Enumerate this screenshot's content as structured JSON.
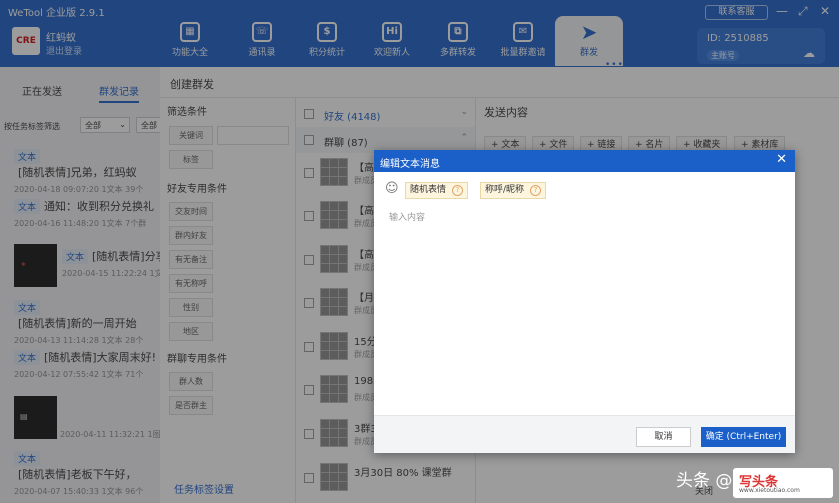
{
  "app": {
    "title": "WeTool 企业版 2.9.1",
    "support": "联系客服",
    "controls": [
      "—",
      "⤢",
      "✕"
    ]
  },
  "user": {
    "avatar_text": "CRE",
    "name": "红蚂蚁",
    "logout": "退出登录"
  },
  "nav": [
    {
      "label": "功能大全",
      "icon": "▦"
    },
    {
      "label": "通讯录",
      "icon": "☏"
    },
    {
      "label": "积分统计",
      "icon": "$"
    },
    {
      "label": "欢迎新人",
      "icon": "Hi"
    },
    {
      "label": "多群转发",
      "icon": "⧉"
    },
    {
      "label": "批量群邀请",
      "icon": "✉"
    },
    {
      "label": "群发",
      "icon": "➤"
    }
  ],
  "nav_more": "•••",
  "account": {
    "id": "ID: 2510885",
    "badge": "主账号"
  },
  "left": {
    "tabs": [
      "正在发送",
      "群发记录"
    ],
    "filter_label": "按任务标签筛选",
    "filter_sel1": "全部",
    "filter_sel2": "全部",
    "messages": [
      {
        "tag": "文本",
        "text": "[随机表情]兄弟，红蚂蚁",
        "meta": "2020-04-18 09:07:20  1文本  39个"
      },
      {
        "tag": "文本",
        "text": "通知：收到积分兑换礼",
        "meta": "2020-04-16 11:48:20  1文本  7个群"
      },
      {
        "tag": "文本",
        "text": "[随机表情]分享",
        "meta": "2020-04-15 11:22:24  1文本"
      },
      {
        "tag": "文本",
        "text": "[随机表情]新的一周开始",
        "meta": "2020-04-13 11:14:28  1文本  28个"
      },
      {
        "tag": "文本",
        "text": "[随机表情]大家周末好!",
        "meta": "2020-04-12 07:55:42  1文本  71个"
      },
      {
        "tag": "",
        "text": "",
        "meta": "2020-04-11 11:32:21  1图片"
      },
      {
        "tag": "文本",
        "text": "[随机表情]老板下午好，",
        "meta": "2020-04-07 15:40:33  1文本  96个"
      }
    ]
  },
  "main": {
    "title": "创建群发",
    "filter_head": "筛选条件",
    "keyword": "关键词",
    "tags": "标签",
    "friend_head": "好友专用条件",
    "friend_btns": [
      "交友时间",
      "群内好友",
      "有无备注",
      "有无称呼",
      "性别",
      "地区"
    ],
    "group_head": "群聊专用条件",
    "group_btns": [
      "群人数",
      "是否群主"
    ],
    "task_tags": "任务标签设置",
    "friends_group": "好友 (4148)",
    "chats_group": "群聊 (87)",
    "chats": [
      {
        "name": "【高",
        "sub": "群成员"
      },
      {
        "name": "【高",
        "sub": "群成员"
      },
      {
        "name": "【高",
        "sub": "群成员"
      },
      {
        "name": "【月",
        "sub": "群成员"
      },
      {
        "name": "15分",
        "sub": "群成员"
      },
      {
        "name": "1983",
        "sub": "群成员"
      },
      {
        "name": "3群3",
        "sub": "群成员"
      },
      {
        "name": "3月30日  80%  课堂群",
        "sub": ""
      }
    ],
    "send_head": "发送内容",
    "send_btns": [
      "+ 文本",
      "+ 文件",
      "+ 链接",
      "+ 名片",
      "+ 收藏夹",
      "+ 素材库"
    ],
    "close": "关闭"
  },
  "modal": {
    "title": "编辑文本消息",
    "emoji": "☺",
    "ph1": "随机表情",
    "ph2": "称呼/昵称",
    "input_placeholder": "输入内容",
    "cancel": "取消",
    "ok": "确定 (Ctrl+Enter)"
  },
  "watermark": {
    "text": "头条 @",
    "logo": "写头条",
    "url": "www.xietoutiao.com"
  }
}
